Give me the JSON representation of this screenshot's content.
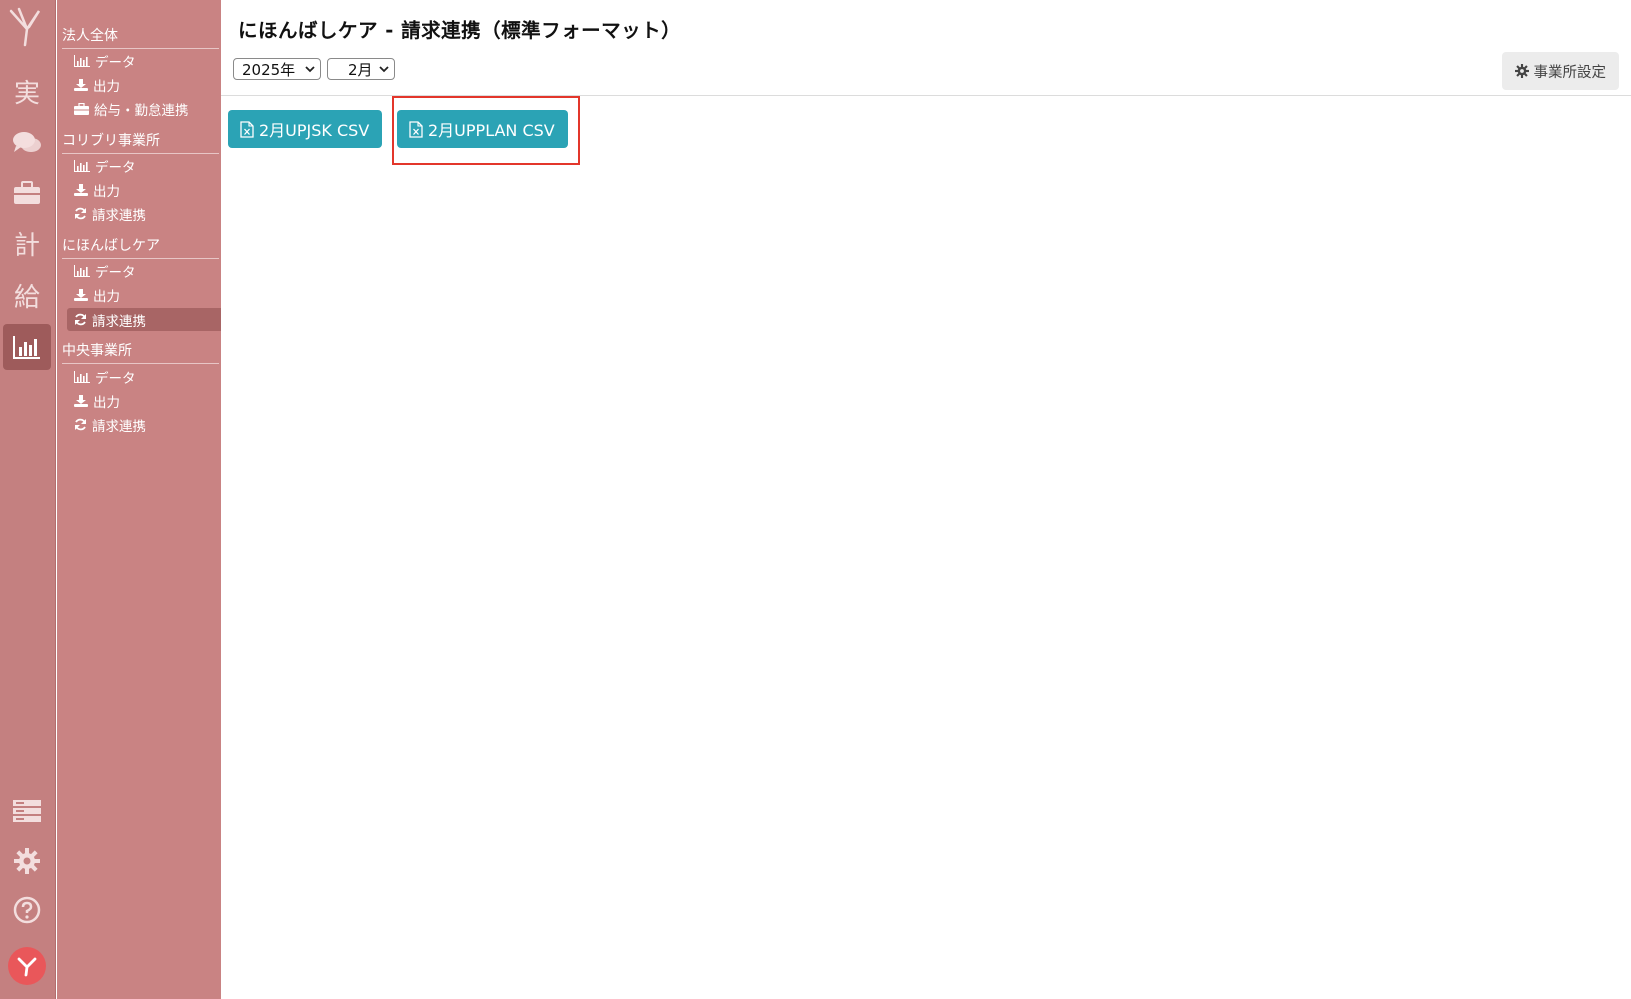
{
  "rail": {
    "items": [
      {
        "name": "logo",
        "kanji": ""
      },
      {
        "name": "jisseki",
        "kanji": "実"
      },
      {
        "name": "chat",
        "kanji": ""
      },
      {
        "name": "business",
        "kanji": ""
      },
      {
        "name": "keikaku",
        "kanji": "計"
      },
      {
        "name": "kyuyo",
        "kanji": "給"
      },
      {
        "name": "report",
        "kanji": "",
        "active": true
      }
    ],
    "kanji_jisseki": "実",
    "kanji_keikaku": "計",
    "kanji_kyuyo": "給",
    "bottom_icons": [
      "list-icon",
      "gear-icon",
      "help-icon",
      "avatar-logo-icon"
    ]
  },
  "sidebar": {
    "sections": [
      {
        "title": "法人全体",
        "items": [
          {
            "label": "データ",
            "icon": "bar-chart-icon"
          },
          {
            "label": "出力",
            "icon": "download-icon"
          },
          {
            "label": "給与・勤怠連携",
            "icon": "briefcase-icon"
          }
        ]
      },
      {
        "title": "コリブリ事業所",
        "items": [
          {
            "label": "データ",
            "icon": "bar-chart-icon"
          },
          {
            "label": "出力",
            "icon": "download-icon"
          },
          {
            "label": "請求連携",
            "icon": "refresh-icon"
          }
        ]
      },
      {
        "title": "にほんばしケア",
        "items": [
          {
            "label": "データ",
            "icon": "bar-chart-icon"
          },
          {
            "label": "出力",
            "icon": "download-icon"
          },
          {
            "label": "請求連携",
            "icon": "refresh-icon",
            "active": true
          }
        ]
      },
      {
        "title": "中央事業所",
        "items": [
          {
            "label": "データ",
            "icon": "bar-chart-icon"
          },
          {
            "label": "出力",
            "icon": "download-icon"
          },
          {
            "label": "請求連携",
            "icon": "refresh-icon"
          }
        ]
      }
    ]
  },
  "main": {
    "title": "にほんばしケア - 請求連携（標準フォーマット）",
    "year_select": "2025年",
    "month_select": "2月",
    "settings_label": "事業所設定",
    "buttons": [
      {
        "label": "2月UPJSK CSV",
        "icon": "file-excel-icon"
      },
      {
        "label": "2月UPPLAN CSV",
        "icon": "file-excel-icon",
        "highlighted": true
      }
    ]
  },
  "colors": {
    "rail_bg": "#c48080",
    "menu_bg": "#c98383",
    "active_item": "#a86565",
    "csv_button": "#2ba3b5",
    "highlight_border": "#e3362b"
  }
}
